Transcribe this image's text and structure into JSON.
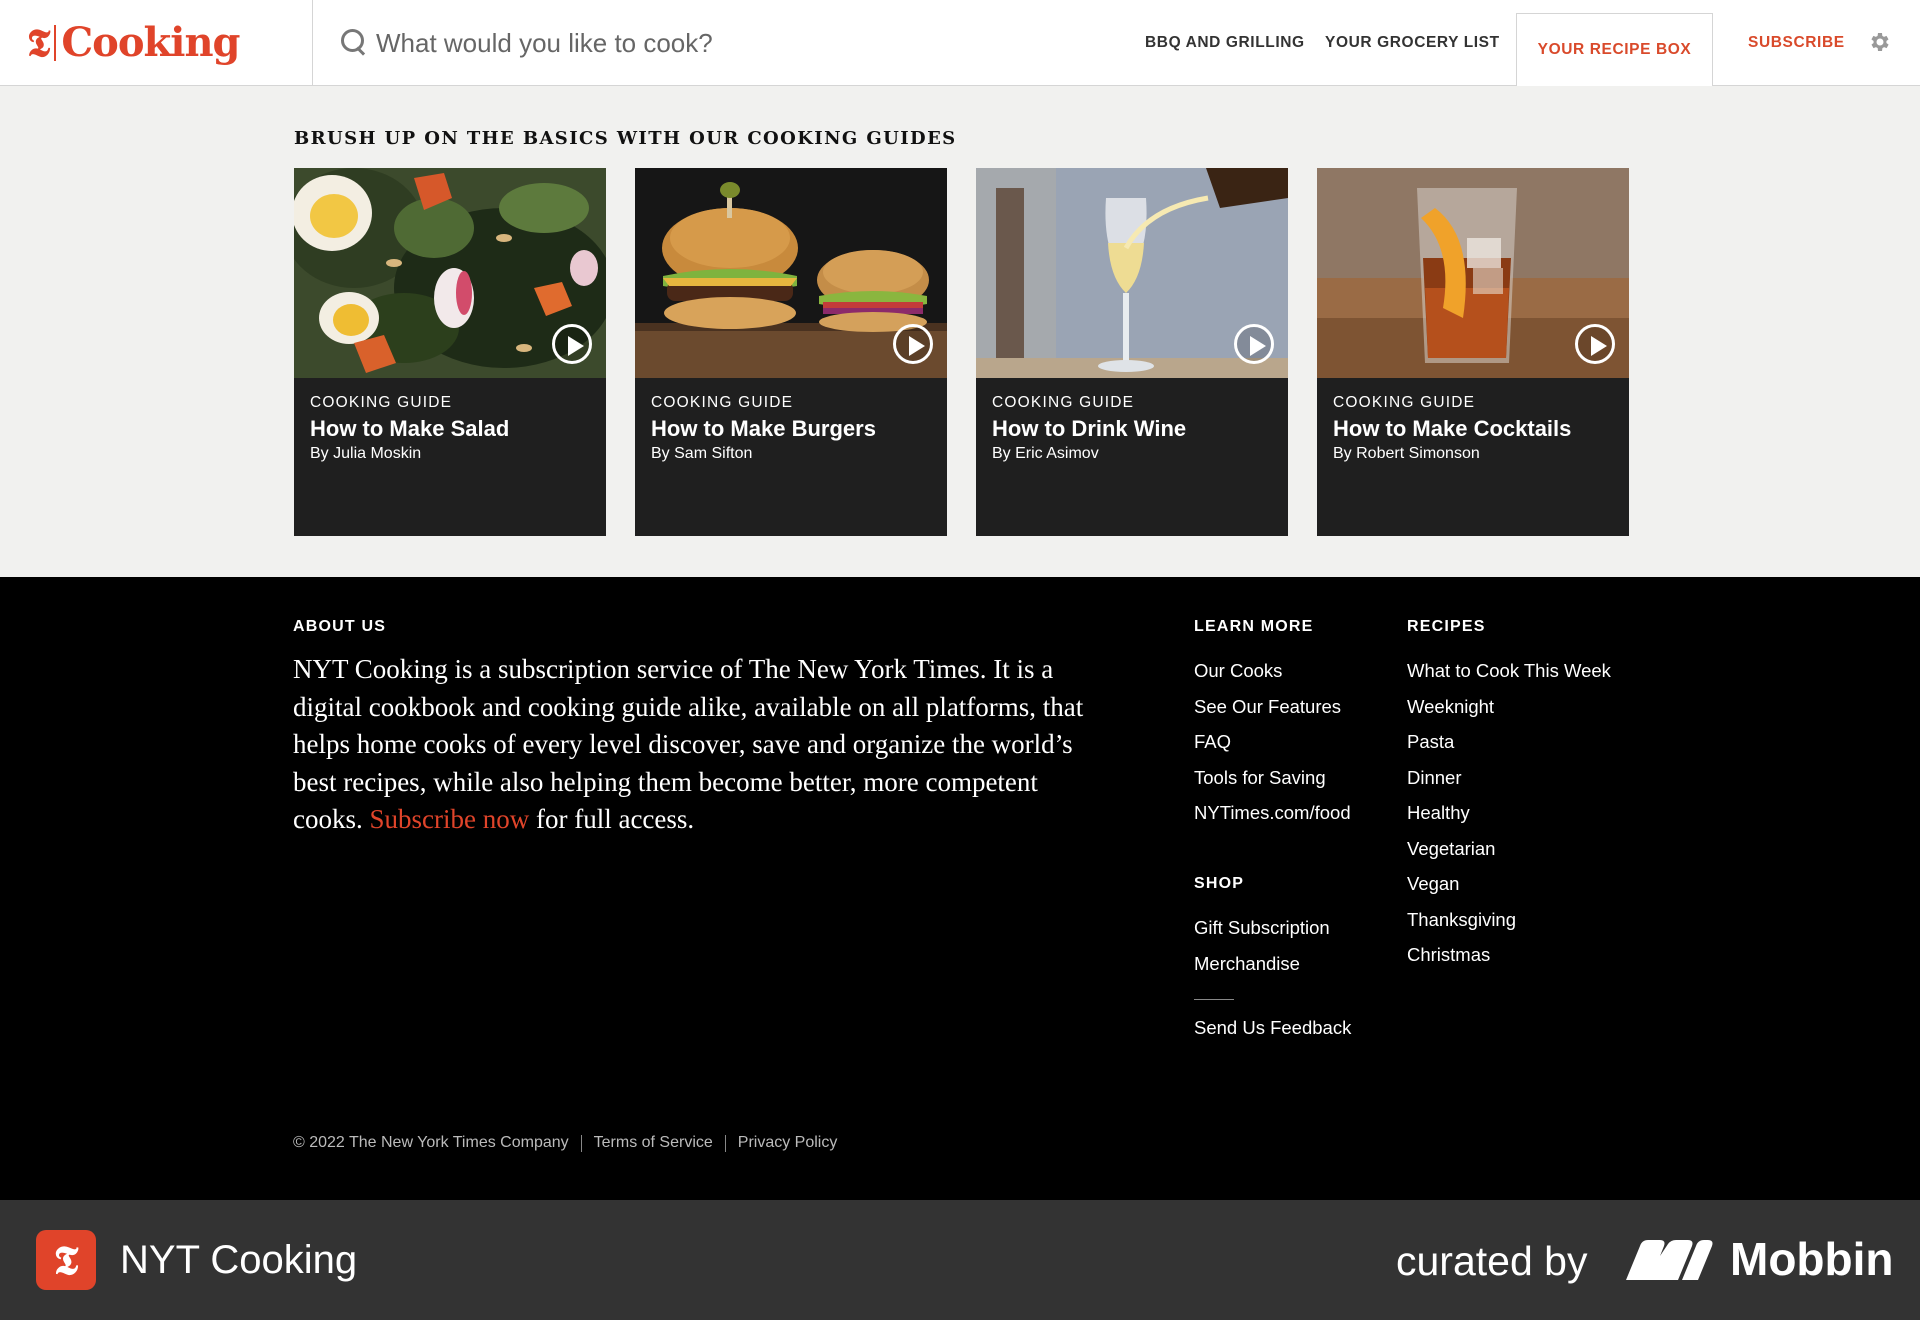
{
  "header": {
    "logo_mark": "𝕿",
    "logo_text": "Cooking",
    "search_placeholder": "What would you like to cook?",
    "nav": {
      "bbq": "BBQ AND GRILLING",
      "grocery": "YOUR GROCERY LIST",
      "recipe_box": "YOUR RECIPE BOX",
      "subscribe": "SUBSCRIBE"
    },
    "icons": {
      "search": "search-icon",
      "settings": "gear-icon"
    }
  },
  "guides": {
    "title": "BRUSH UP ON THE BASICS WITH OUR COOKING GUIDES",
    "cards": [
      {
        "kicker": "COOKING GUIDE",
        "title": "How to Make Salad",
        "byline": "By Julia Moskin"
      },
      {
        "kicker": "COOKING GUIDE",
        "title": "How to Make Burgers",
        "byline": "By Sam Sifton"
      },
      {
        "kicker": "COOKING GUIDE",
        "title": "How to Drink Wine",
        "byline": "By Eric Asimov"
      },
      {
        "kicker": "COOKING GUIDE",
        "title": "How to Make Cocktails",
        "byline": "By Robert Simonson"
      }
    ]
  },
  "footer": {
    "about": {
      "heading": "ABOUT US",
      "text_before": "NYT Cooking is a subscription service of The New York Times. It is a digital cookbook and cooking guide alike, available on all platforms, that helps home cooks of every level discover, save and organize the world’s best recipes, while also helping them become better, more competent cooks. ",
      "link": "Subscribe now",
      "text_after": " for full access."
    },
    "learn_more": {
      "heading": "LEARN MORE",
      "items": [
        "Our Cooks",
        "See Our Features",
        "FAQ",
        "Tools for Saving",
        "NYTimes.com/food"
      ]
    },
    "shop": {
      "heading": "SHOP",
      "items": [
        "Gift Subscription",
        "Merchandise"
      ]
    },
    "feedback": "Send Us Feedback",
    "recipes": {
      "heading": "RECIPES",
      "items": [
        "What to Cook This Week",
        "Weeknight",
        "Pasta",
        "Dinner",
        "Healthy",
        "Vegetarian",
        "Vegan",
        "Thanksgiving",
        "Christmas"
      ]
    },
    "legal": {
      "copyright": "© 2022 The New York Times Company",
      "terms": "Terms of Service",
      "privacy": "Privacy Policy"
    }
  },
  "bottombar": {
    "app_icon_glyph": "𝕿",
    "app_name": "NYT Cooking",
    "curated": "curated by",
    "brand": "Mobbin"
  },
  "colors": {
    "brand_red": "#e0442a",
    "footer_bg": "#000000",
    "card_bg": "#1f1f1f",
    "page_bg": "#f1f1ef",
    "bottombar_bg": "#333333"
  }
}
